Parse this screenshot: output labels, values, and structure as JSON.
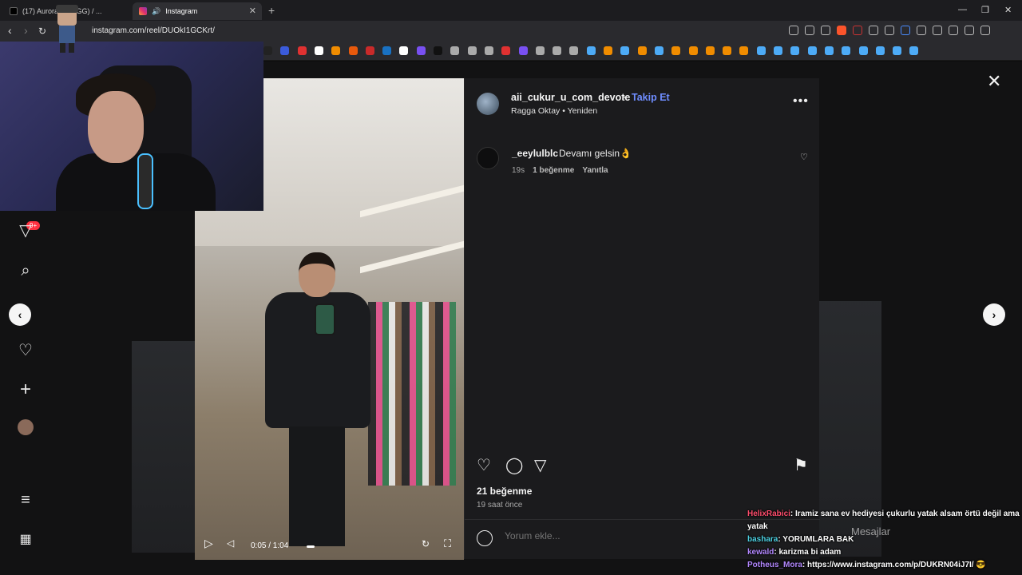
{
  "browser": {
    "tabs": [
      {
        "label": "(17) AuroraCS2_GG) / ...",
        "active": false
      },
      {
        "label": "Instagram",
        "active": true
      }
    ],
    "url": "instagram.com/reel/DUOkI1GCKrt/"
  },
  "post": {
    "username": "aii_cukur_u_com_devote",
    "follow_label": "Takip Et",
    "audio": "Ragga Oktay • Yeniden",
    "comments": [
      {
        "user": "_eeylulblc",
        "text": "Devamı gelsin👌",
        "time": "19s",
        "likes": "1 beğenme",
        "reply": "Yanıtla"
      }
    ],
    "likes": "21 beğenme",
    "time_ago": "19 saat önce",
    "comment_placeholder": "Yorum ekle..."
  },
  "video": {
    "time": "0:05 / 1:04"
  },
  "sidebar": {
    "notification_badge": "9+"
  },
  "messages_label": "Mesajlar",
  "chat": [
    {
      "user": "HelixRabici",
      "color": "#ff4d6d",
      "text": ": Iramiz sana ev hediyesi çukurlu yatak alsam örtü değil ama yatak"
    },
    {
      "user": "bashara",
      "color": "#4dd0e1",
      "text": ": YORUMLARA BAK"
    },
    {
      "user": "kewald",
      "color": "#b388ff",
      "text": ": karizma bi adam"
    },
    {
      "user": "Potheus_Mora",
      "color": "#b388ff",
      "text": ": https://www.instagram.com/p/DUKRN04iJ7I/ 😎"
    }
  ],
  "colors": {
    "accent": "#6f8dff",
    "panel": "#1b1b1d",
    "badge": "#ff3040"
  }
}
